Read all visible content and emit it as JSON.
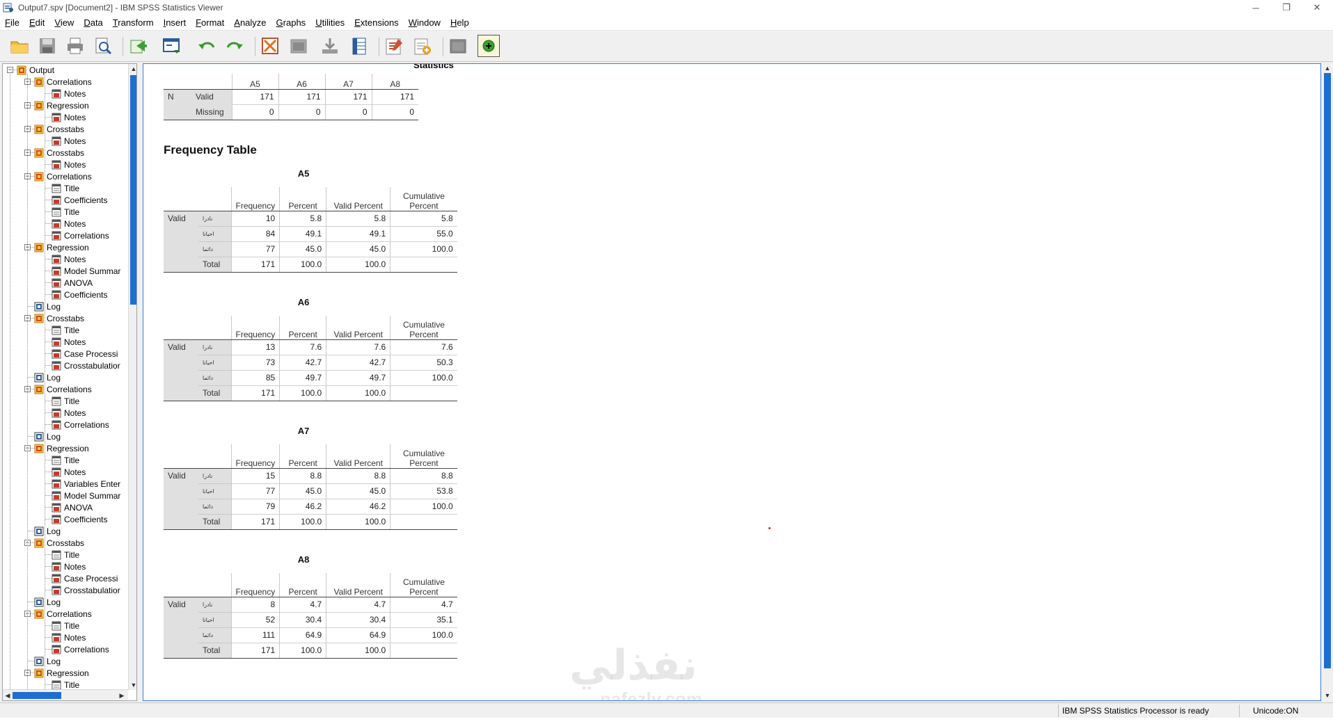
{
  "window": {
    "title": "Output7.spv [Document2] - IBM SPSS Statistics Viewer",
    "controls": [
      "─",
      "❐",
      "✕"
    ]
  },
  "menu": [
    {
      "label": "File",
      "ul": "F",
      "rest": "ile"
    },
    {
      "label": "Edit",
      "ul": "E",
      "rest": "dit"
    },
    {
      "label": "View",
      "ul": "V",
      "rest": "iew"
    },
    {
      "label": "Data",
      "ul": "D",
      "rest": "ata"
    },
    {
      "label": "Transform",
      "ul": "T",
      "rest": "ransform"
    },
    {
      "label": "Insert",
      "ul": "I",
      "rest": "nsert"
    },
    {
      "label": "Format",
      "ul": "F",
      "rest": "ormat"
    },
    {
      "label": "Analyze",
      "ul": "A",
      "rest": "nalyze"
    },
    {
      "label": "Graphs",
      "ul": "G",
      "rest": "raphs"
    },
    {
      "label": "Utilities",
      "ul": "U",
      "rest": "tilities"
    },
    {
      "label": "Extensions",
      "ul": "E",
      "rest": "xtensions"
    },
    {
      "label": "Window",
      "ul": "W",
      "rest": "indow"
    },
    {
      "label": "Help",
      "ul": "H",
      "rest": "elp"
    }
  ],
  "toolbar": [
    "open-folder-icon",
    "save-icon",
    "print-icon",
    "print-preview-icon",
    "export-icon",
    "recall-dialog-icon",
    "undo-icon",
    "redo-icon",
    "goto-data-icon",
    "goto-case-icon",
    "goto-variable-icon",
    "variables-icon",
    "insert-output-icon",
    "create-title-icon",
    "designate-window-icon",
    "show-all-icon",
    "add-icon"
  ],
  "outline": {
    "rows": [
      {
        "label": "Output",
        "level": 0,
        "icon": "book",
        "exp": "-"
      },
      {
        "label": "Correlations",
        "level": 1,
        "icon": "book",
        "exp": "-"
      },
      {
        "label": "Notes",
        "level": 2,
        "icon": "note"
      },
      {
        "label": "Regression",
        "level": 1,
        "icon": "book",
        "exp": "-"
      },
      {
        "label": "Notes",
        "level": 2,
        "icon": "note"
      },
      {
        "label": "Crosstabs",
        "level": 1,
        "icon": "book",
        "exp": "-"
      },
      {
        "label": "Notes",
        "level": 2,
        "icon": "note"
      },
      {
        "label": "Crosstabs",
        "level": 1,
        "icon": "book",
        "exp": "-"
      },
      {
        "label": "Notes",
        "level": 2,
        "icon": "note"
      },
      {
        "label": "Correlations",
        "level": 1,
        "icon": "book",
        "exp": "-"
      },
      {
        "label": "Title",
        "level": 2,
        "icon": "doc"
      },
      {
        "label": "Coefficients",
        "level": 2,
        "icon": "note"
      },
      {
        "label": "Title",
        "level": 2,
        "icon": "doc"
      },
      {
        "label": "Notes",
        "level": 2,
        "icon": "note"
      },
      {
        "label": "Correlations",
        "level": 2,
        "icon": "note"
      },
      {
        "label": "Regression",
        "level": 1,
        "icon": "book",
        "exp": "-"
      },
      {
        "label": "Notes",
        "level": 2,
        "icon": "note"
      },
      {
        "label": "Model Summar",
        "level": 2,
        "icon": "note"
      },
      {
        "label": "ANOVA",
        "level": 2,
        "icon": "note"
      },
      {
        "label": "Coefficients",
        "level": 2,
        "icon": "note"
      },
      {
        "label": "Log",
        "level": 1,
        "icon": "log"
      },
      {
        "label": "Crosstabs",
        "level": 1,
        "icon": "book",
        "exp": "-"
      },
      {
        "label": "Title",
        "level": 2,
        "icon": "doc"
      },
      {
        "label": "Notes",
        "level": 2,
        "icon": "note"
      },
      {
        "label": "Case Processi",
        "level": 2,
        "icon": "note"
      },
      {
        "label": "Crosstabulatior",
        "level": 2,
        "icon": "note"
      },
      {
        "label": "Log",
        "level": 1,
        "icon": "log"
      },
      {
        "label": "Correlations",
        "level": 1,
        "icon": "book",
        "exp": "-"
      },
      {
        "label": "Title",
        "level": 2,
        "icon": "doc"
      },
      {
        "label": "Notes",
        "level": 2,
        "icon": "note"
      },
      {
        "label": "Correlations",
        "level": 2,
        "icon": "note"
      },
      {
        "label": "Log",
        "level": 1,
        "icon": "log"
      },
      {
        "label": "Regression",
        "level": 1,
        "icon": "book",
        "exp": "-"
      },
      {
        "label": "Title",
        "level": 2,
        "icon": "doc"
      },
      {
        "label": "Notes",
        "level": 2,
        "icon": "note"
      },
      {
        "label": "Variables Enter",
        "level": 2,
        "icon": "note"
      },
      {
        "label": "Model Summar",
        "level": 2,
        "icon": "note"
      },
      {
        "label": "ANOVA",
        "level": 2,
        "icon": "note"
      },
      {
        "label": "Coefficients",
        "level": 2,
        "icon": "note"
      },
      {
        "label": "Log",
        "level": 1,
        "icon": "log"
      },
      {
        "label": "Crosstabs",
        "level": 1,
        "icon": "book",
        "exp": "-"
      },
      {
        "label": "Title",
        "level": 2,
        "icon": "doc"
      },
      {
        "label": "Notes",
        "level": 2,
        "icon": "note"
      },
      {
        "label": "Case Processi",
        "level": 2,
        "icon": "note"
      },
      {
        "label": "Crosstabulatior",
        "level": 2,
        "icon": "note"
      },
      {
        "label": "Log",
        "level": 1,
        "icon": "log"
      },
      {
        "label": "Correlations",
        "level": 1,
        "icon": "book",
        "exp": "-"
      },
      {
        "label": "Title",
        "level": 2,
        "icon": "doc"
      },
      {
        "label": "Notes",
        "level": 2,
        "icon": "note"
      },
      {
        "label": "Correlations",
        "level": 2,
        "icon": "note"
      },
      {
        "label": "Log",
        "level": 1,
        "icon": "log"
      },
      {
        "label": "Regression",
        "level": 1,
        "icon": "book",
        "exp": "-"
      },
      {
        "label": "Title",
        "level": 2,
        "icon": "doc"
      }
    ]
  },
  "statistics": {
    "heading": "Statistics",
    "columns": [
      "A5",
      "A6",
      "A7",
      "A8"
    ],
    "n_label": "N",
    "rows": [
      {
        "label": "Valid",
        "values": [
          "171",
          "171",
          "171",
          "171"
        ]
      },
      {
        "label": "Missing",
        "values": [
          "0",
          "0",
          "0",
          "0"
        ]
      }
    ]
  },
  "frequency_section_title": "Frequency Table",
  "freq_headers": {
    "frequency": "Frequency",
    "percent": "Percent",
    "valid_percent": "Valid Percent",
    "cumulative_1": "Cumulative",
    "cumulative_2": "Percent",
    "valid": "Valid"
  },
  "freq_tables": [
    {
      "title": "A5",
      "rows": [
        {
          "cat": "نادرا",
          "f": "10",
          "p": "5.8",
          "vp": "5.8",
          "cp": "5.8"
        },
        {
          "cat": "احيانا",
          "f": "84",
          "p": "49.1",
          "vp": "49.1",
          "cp": "55.0"
        },
        {
          "cat": "دائما",
          "f": "77",
          "p": "45.0",
          "vp": "45.0",
          "cp": "100.0"
        },
        {
          "cat": "Total",
          "f": "171",
          "p": "100.0",
          "vp": "100.0",
          "cp": ""
        }
      ]
    },
    {
      "title": "A6",
      "rows": [
        {
          "cat": "نادرا",
          "f": "13",
          "p": "7.6",
          "vp": "7.6",
          "cp": "7.6"
        },
        {
          "cat": "احيانا",
          "f": "73",
          "p": "42.7",
          "vp": "42.7",
          "cp": "50.3"
        },
        {
          "cat": "دائما",
          "f": "85",
          "p": "49.7",
          "vp": "49.7",
          "cp": "100.0"
        },
        {
          "cat": "Total",
          "f": "171",
          "p": "100.0",
          "vp": "100.0",
          "cp": ""
        }
      ]
    },
    {
      "title": "A7",
      "rows": [
        {
          "cat": "نادرا",
          "f": "15",
          "p": "8.8",
          "vp": "8.8",
          "cp": "8.8"
        },
        {
          "cat": "احيانا",
          "f": "77",
          "p": "45.0",
          "vp": "45.0",
          "cp": "53.8"
        },
        {
          "cat": "دائما",
          "f": "79",
          "p": "46.2",
          "vp": "46.2",
          "cp": "100.0"
        },
        {
          "cat": "Total",
          "f": "171",
          "p": "100.0",
          "vp": "100.0",
          "cp": ""
        }
      ]
    },
    {
      "title": "A8",
      "rows": [
        {
          "cat": "نادرا",
          "f": "8",
          "p": "4.7",
          "vp": "4.7",
          "cp": "4.7"
        },
        {
          "cat": "احيانا",
          "f": "52",
          "p": "30.4",
          "vp": "30.4",
          "cp": "35.1"
        },
        {
          "cat": "دائما",
          "f": "111",
          "p": "64.9",
          "vp": "64.9",
          "cp": "100.0"
        },
        {
          "cat": "Total",
          "f": "171",
          "p": "100.0",
          "vp": "100.0",
          "cp": ""
        }
      ]
    }
  ],
  "status": {
    "processor": "IBM SPSS Statistics Processor is ready",
    "unicode": "Unicode:ON"
  },
  "watermark": {
    "arabic": "نفذلي",
    "latin": "nafezly.com"
  }
}
